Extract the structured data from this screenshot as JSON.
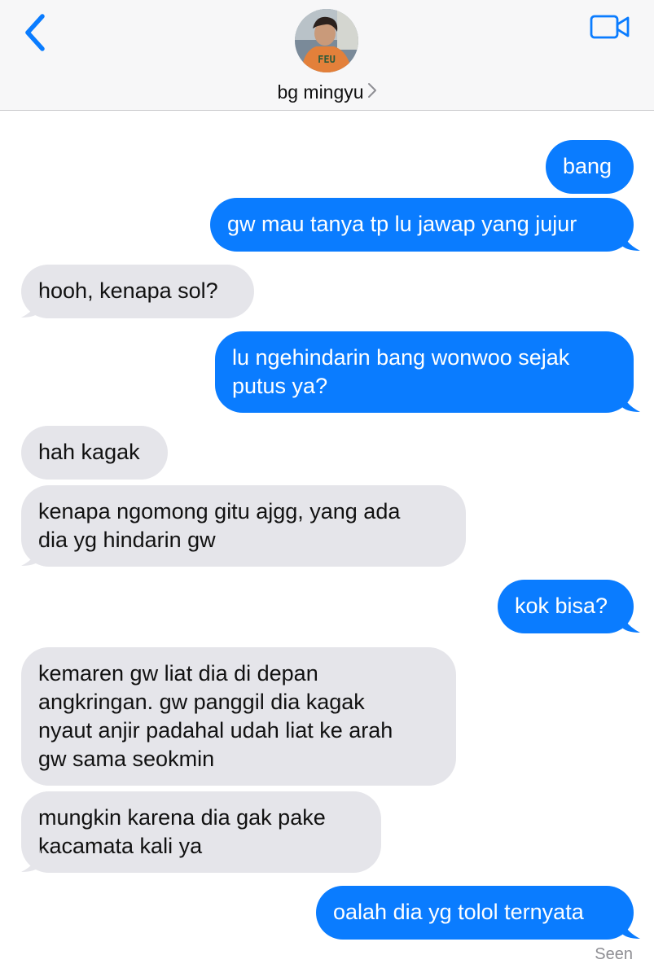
{
  "header": {
    "contact_name": "bg mingyu",
    "back_icon": "chevron-left-icon",
    "video_icon": "video-camera-icon",
    "accent_color": "#0a7cff"
  },
  "messages": [
    {
      "direction": "outgoing",
      "lines": [
        "bang"
      ]
    },
    {
      "direction": "outgoing",
      "lines": [
        "gw mau tanya tp lu jawap yang jujur"
      ]
    },
    {
      "direction": "incoming",
      "lines": [
        "hooh, kenapa sol?"
      ]
    },
    {
      "direction": "outgoing",
      "lines": [
        "lu ngehindarin bang wonwoo sejak",
        "putus ya?"
      ]
    },
    {
      "direction": "incoming",
      "lines": [
        "hah kagak"
      ]
    },
    {
      "direction": "incoming",
      "lines": [
        "kenapa ngomong gitu ajgg, yang ada",
        "dia yg hindarin gw"
      ]
    },
    {
      "direction": "outgoing",
      "lines": [
        "kok bisa?"
      ]
    },
    {
      "direction": "incoming",
      "lines": [
        "kemaren gw liat dia di depan",
        "angkringan. gw panggil dia kagak",
        "nyaut anjir padahal udah liat ke arah",
        "gw sama seokmin"
      ]
    },
    {
      "direction": "incoming",
      "lines": [
        "mungkin karena dia gak pake",
        "kacamata kali ya"
      ]
    },
    {
      "direction": "outgoing",
      "lines": [
        "oalah dia yg tolol ternyata"
      ]
    }
  ],
  "status": {
    "seen_label": "Seen"
  }
}
